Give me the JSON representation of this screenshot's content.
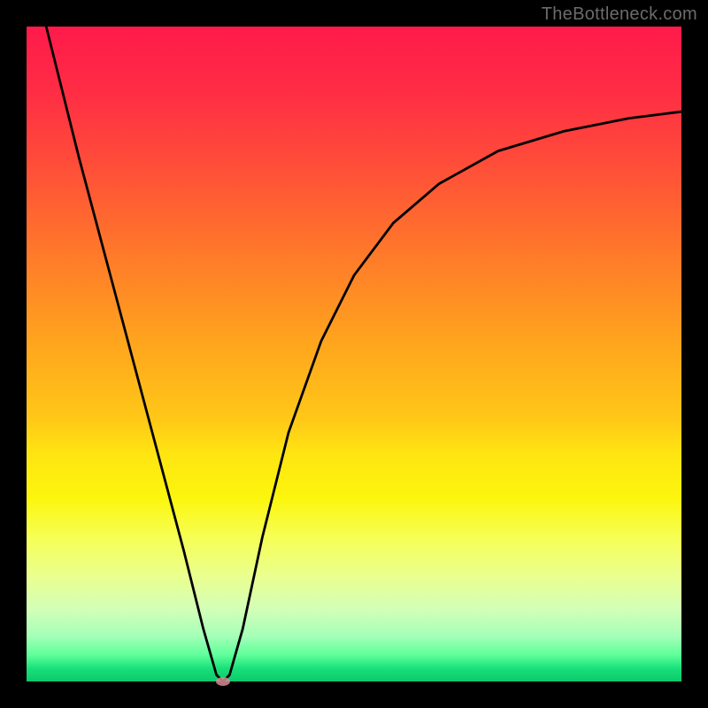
{
  "watermark": "TheBottleneck.com",
  "chart_data": {
    "type": "line",
    "title": "",
    "xlabel": "",
    "ylabel": "",
    "xlim": [
      0,
      100
    ],
    "ylim": [
      0,
      100
    ],
    "grid": false,
    "legend": false,
    "background_gradient": {
      "direction": "vertical",
      "stops": [
        {
          "pos": 0.0,
          "color": "#ff1a4b",
          "meaning": "high bottleneck"
        },
        {
          "pos": 0.5,
          "color": "#ffaa1c",
          "meaning": "moderate"
        },
        {
          "pos": 0.72,
          "color": "#fcf60d",
          "meaning": "slight"
        },
        {
          "pos": 1.0,
          "color": "#0cc96b",
          "meaning": "optimal"
        }
      ]
    },
    "series": [
      {
        "name": "bottleneck-curve",
        "color": "#000000",
        "points": [
          {
            "x": 3,
            "y": 100
          },
          {
            "x": 5,
            "y": 92
          },
          {
            "x": 8,
            "y": 80
          },
          {
            "x": 12,
            "y": 65
          },
          {
            "x": 16,
            "y": 50
          },
          {
            "x": 20,
            "y": 35
          },
          {
            "x": 24,
            "y": 20
          },
          {
            "x": 27,
            "y": 8
          },
          {
            "x": 29,
            "y": 1
          },
          {
            "x": 30,
            "y": 0
          },
          {
            "x": 31,
            "y": 1
          },
          {
            "x": 33,
            "y": 8
          },
          {
            "x": 36,
            "y": 22
          },
          {
            "x": 40,
            "y": 38
          },
          {
            "x": 45,
            "y": 52
          },
          {
            "x": 50,
            "y": 62
          },
          {
            "x": 56,
            "y": 70
          },
          {
            "x": 63,
            "y": 76
          },
          {
            "x": 72,
            "y": 81
          },
          {
            "x": 82,
            "y": 84
          },
          {
            "x": 92,
            "y": 86
          },
          {
            "x": 100,
            "y": 87
          }
        ]
      }
    ],
    "highlight_point": {
      "x": 30,
      "y": 0,
      "color": "#d78a8f"
    }
  }
}
